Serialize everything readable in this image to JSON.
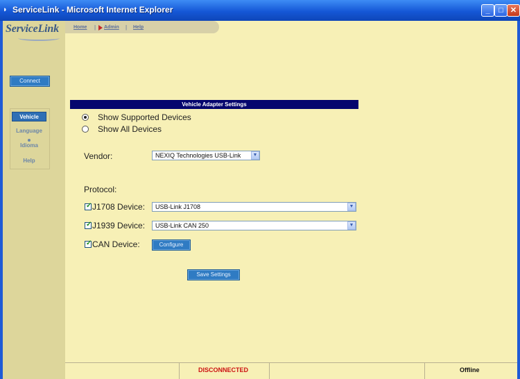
{
  "window": {
    "title": "ServiceLink - Microsoft Internet Explorer"
  },
  "sidebar": {
    "logo": "ServiceLink",
    "connect_label": "Connect",
    "nav": [
      {
        "label": "Vehicle",
        "active": true
      },
      {
        "label": "Language",
        "active": false
      },
      {
        "label": "Idioma",
        "active": false
      },
      {
        "label": "Help",
        "active": false
      }
    ]
  },
  "topnav": {
    "home": "Home",
    "admin": "Admin",
    "help": "Help",
    "separator": "|"
  },
  "settings": {
    "title": "Vehicle Adapter Settings",
    "radio_supported": "Show Supported Devices",
    "radio_all": "Show All Devices",
    "selected_radio": "supported",
    "vendor_label": "Vendor:",
    "vendor_value": "NEXIQ Technologies USB-Link",
    "protocol_label": "Protocol:",
    "j1708_label": "J1708 Device:",
    "j1708_value": "USB-Link J1708",
    "j1939_label": "J1939 Device:",
    "j1939_value": "USB-Link CAN 250",
    "can_label": "CAN Device:",
    "configure_label": "Configure",
    "save_label": "Save Settings"
  },
  "status": {
    "connection": "DISCONNECTED",
    "mode": "Offline"
  },
  "colors": {
    "page_bg": "#f7f0b6",
    "sidebar_bg": "#ddd69b",
    "header_bg": "#05056e",
    "button_bg": "#2f7bc3",
    "status_red": "#cc1111"
  }
}
